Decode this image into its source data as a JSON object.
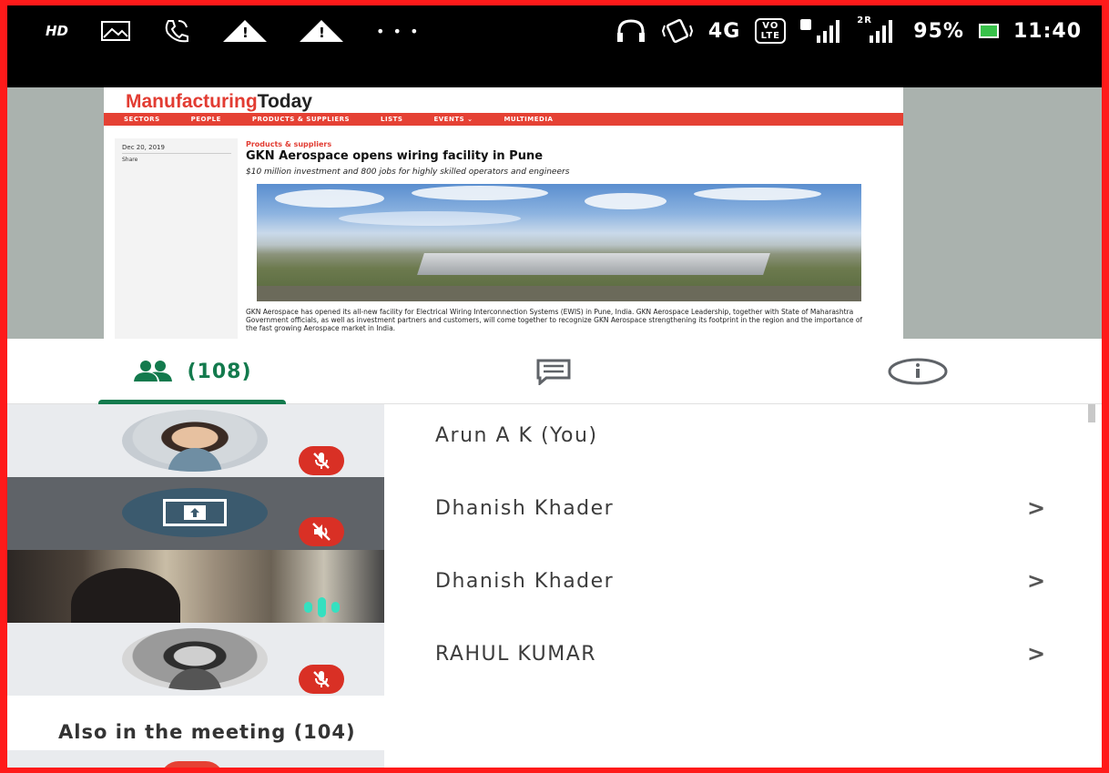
{
  "status_bar": {
    "hd": "HD",
    "dots": "• • •",
    "network": "4G",
    "volte": "VO LTE",
    "sim2": "2R",
    "battery": "95%",
    "time": "11:40"
  },
  "shared_page": {
    "logo_part1": "Manufacturing",
    "logo_part2": "Today",
    "nav": [
      "SECTORS",
      "PEOPLE",
      "PRODUCTS & SUPPLIERS",
      "LISTS",
      "EVENTS ⌄",
      "MULTIMEDIA"
    ],
    "date": "Dec 20, 2019",
    "share": "Share",
    "category": "Products & suppliers",
    "headline": "GKN Aerospace opens wiring facility in Pune",
    "subhead": "$10 million investment and 800 jobs for highly skilled operators and engineers",
    "body": "GKN Aerospace has opened its all-new facility for Electrical Wiring Interconnection Systems (EWIS) in Pune, India. GKN Aerospace Leadership, together with State of Maharashtra Government officials, as well as investment partners and customers, will come together to recognize GKN Aerospace strengthening its footprint in the region and the importance of the fast growing Aerospace market in India."
  },
  "tabs": {
    "people_count": "(108)"
  },
  "participants": [
    {
      "name": "Arun A K (You)"
    },
    {
      "name": "Dhanish Khader"
    },
    {
      "name": "Dhanish Khader"
    },
    {
      "name": "RAHUL KUMAR"
    }
  ],
  "chevron": ">",
  "also_in_meeting": "Also in the meeting (104)",
  "colors": {
    "accent": "#137a4d",
    "mic_off": "#d93025",
    "frame": "#ff1a1a"
  }
}
